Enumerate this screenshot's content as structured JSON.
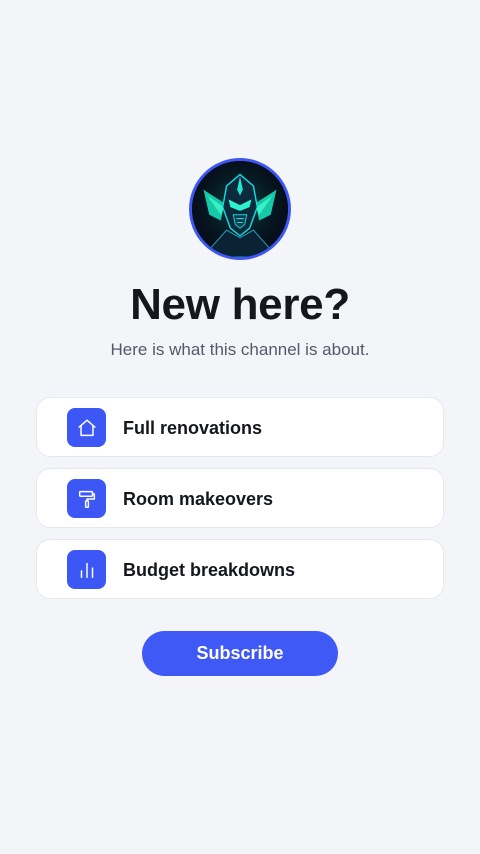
{
  "header": {
    "title": "New here?",
    "subtitle": "Here is what this channel is about."
  },
  "avatar": {
    "icon": "armored-knight-avatar-icon"
  },
  "topics": [
    {
      "label": "Full renovations",
      "icon": "house-icon"
    },
    {
      "label": "Room makeovers",
      "icon": "paint-roller-icon"
    },
    {
      "label": "Budget breakdowns",
      "icon": "bar-chart-icon"
    }
  ],
  "cta": {
    "label": "Subscribe"
  },
  "colors": {
    "accent": "#3f59f6",
    "background": "#f4f5f9",
    "title_text": "#15171e",
    "subtitle_text": "#55586a",
    "card_background": "#ffffff"
  }
}
